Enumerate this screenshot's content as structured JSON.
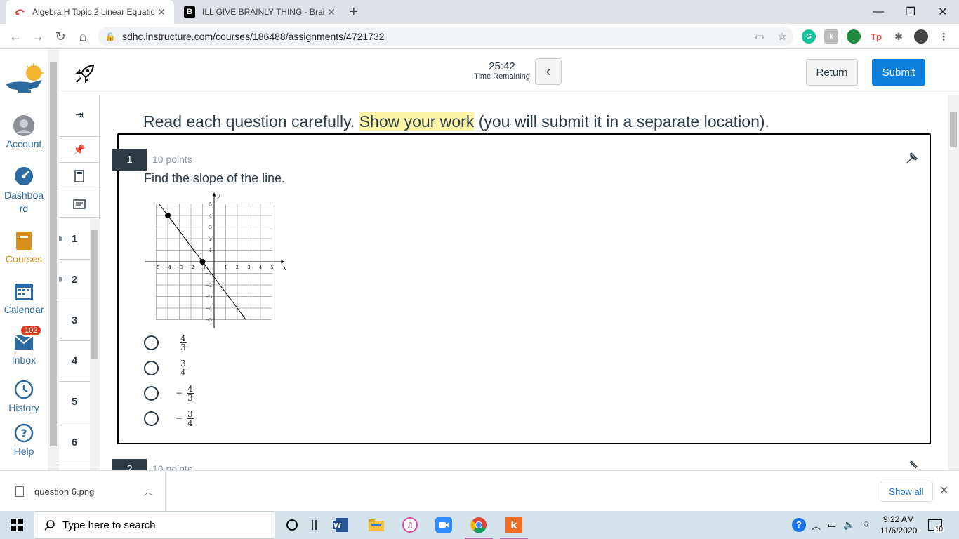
{
  "browser": {
    "tabs": [
      {
        "title": "Algebra H Topic 2 Linear Equatio",
        "active": true
      },
      {
        "title": "ILL GIVE BRAINLY THING - Brainly",
        "active": false
      }
    ],
    "url": "sdhc.instructure.com/courses/186488/assignments/4721732"
  },
  "global_nav": {
    "items": [
      {
        "label": "Account"
      },
      {
        "label": "Dashboa rd"
      },
      {
        "label": "Courses",
        "active": true
      },
      {
        "label": "Calendar"
      },
      {
        "label": "Inbox",
        "badge": "102"
      },
      {
        "label": "History"
      },
      {
        "label": "Help"
      }
    ]
  },
  "quiz_header": {
    "time": "25:42",
    "time_label": "Time Remaining",
    "return_label": "Return",
    "submit_label": "Submit"
  },
  "question_nav": {
    "numbers": [
      "1",
      "2",
      "3",
      "4",
      "5",
      "6"
    ]
  },
  "instructions": {
    "before": "Read each question carefully. ",
    "highlight": "Show your work",
    "after": " (you will submit it in a separate location)."
  },
  "question1": {
    "number": "1",
    "points": "10 points",
    "text": "Find the slope of the line.",
    "answers": [
      {
        "neg": "",
        "num": "4",
        "den": "3"
      },
      {
        "neg": "",
        "num": "3",
        "den": "4"
      },
      {
        "neg": "−",
        "num": "4",
        "den": "3"
      },
      {
        "neg": "−",
        "num": "3",
        "den": "4"
      }
    ],
    "graph": {
      "x_label": "x",
      "y_label": "y",
      "x_ticks": [
        "−5",
        "−4",
        "−3",
        "−2",
        "−1",
        "1",
        "2",
        "3",
        "4",
        "5"
      ],
      "y_ticks": [
        "5",
        "4",
        "3",
        "2",
        "1",
        "−1",
        "−2",
        "−3",
        "−4",
        "−5"
      ],
      "range": [
        -5,
        5
      ],
      "points": [
        [
          -4,
          4
        ],
        [
          -1,
          0
        ]
      ]
    }
  },
  "question2": {
    "number": "2",
    "points": "10 points"
  },
  "downloads": {
    "file": "question 6.png",
    "show_all": "Show all"
  },
  "taskbar": {
    "search_placeholder": "Type here to search",
    "time": "9:22 AM",
    "date": "11/6/2020",
    "notifications": "10"
  }
}
